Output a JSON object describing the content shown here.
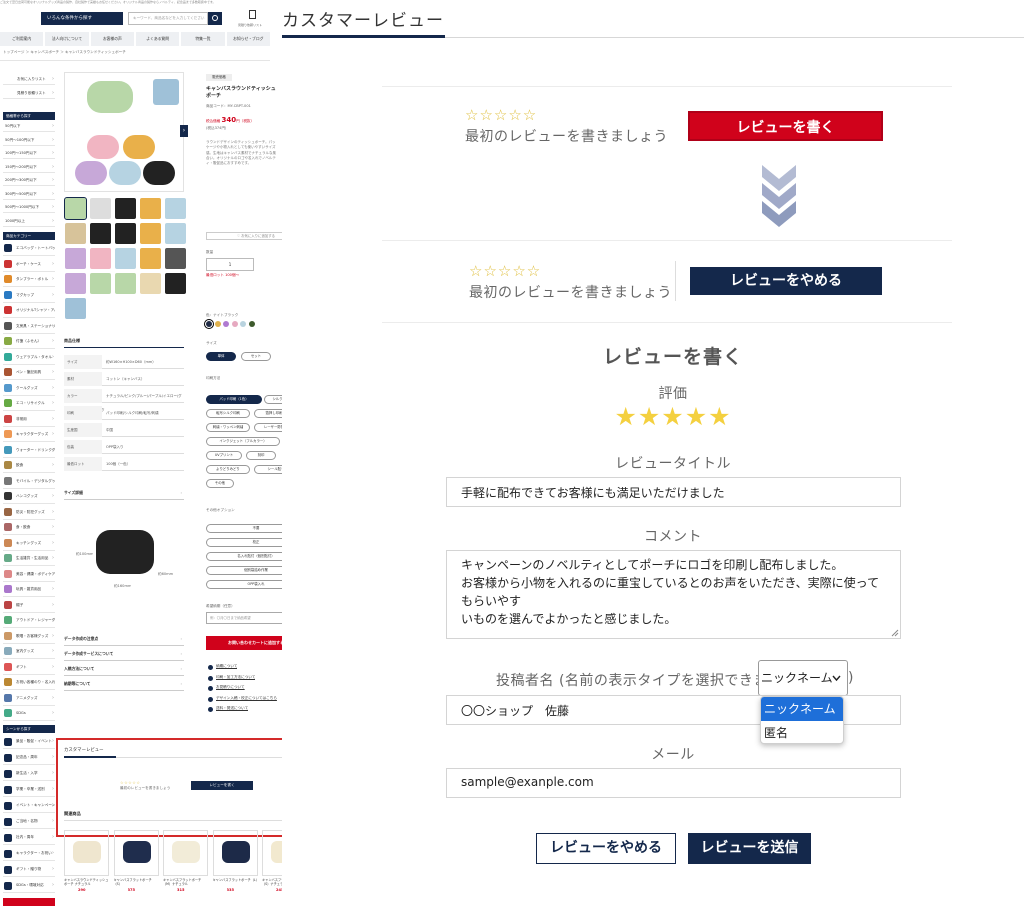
{
  "shop": {
    "header_notice": "ご注文で翌日出荷可能なオリジナルグッズ商品の製作、自社製作で実績もお任せください。オリジナル商品の製作ならノベルティ、記念品まで多数取扱中です。",
    "search_by_category": "いろんな条件から探す",
    "search_placeholder": "キーワード、商品名などを入力してください",
    "cart_label": "見積り依頼リスト",
    "global_nav": [
      "ご利用案内",
      "法人向けについて",
      "お客様の声",
      "よくある質問",
      "特集一覧",
      "お知らせ・ブログ"
    ],
    "breadcrumb": "トップページ ＞ キャンバスポーチ ＞ キャンバスラウンドティッシュポーチ",
    "side_top": [
      "お気に入りリスト",
      "見積り依頼リスト"
    ],
    "price_heading": "価格帯から探す",
    "price_ranges": [
      "50円以下",
      "50円〜100円以下",
      "100円〜150円以下",
      "150円〜200円以下",
      "200円〜300円以下",
      "300円〜500円以下",
      "500円〜1000円以下",
      "1000円以上"
    ],
    "category_heading": "商品カテゴリー",
    "categories": [
      "エコバッグ・トートバッグ",
      "ポーチ・ケース",
      "タンブラー・ボトル",
      "マグカップ",
      "オリジナルTシャツ・アパレル",
      "文房具・ステーショナリー",
      "付箋（ふせん）",
      "ウェアラブル・タオル",
      "ペン・筆記用具",
      "クールグッズ",
      "エコ・リサイクル",
      "非常用",
      "キャラクターグッズ",
      "ウォーター・ドリンクグッズ",
      "飲食",
      "モバイル・デジタルグッズ",
      "ハンコグッズ",
      "防災・防犯グッズ",
      "食・飲食",
      "キッチングッズ",
      "生活雑貨・生活用品",
      "美容・健康・ボディケア",
      "玩具・雑貨用品",
      "帽子",
      "アウトドア・レジャーグッズ",
      "歌唱・お客様グッズ",
      "室内グッズ",
      "ギフト",
      "お祝い各種のり・名入れグッズ",
      "アニメグッズ",
      "SDGs"
    ],
    "scene_heading": "シーンから探す",
    "scenes": [
      "景品・販促・イベント",
      "記念品・周年",
      "新生活・入学",
      "学業・卒業・送別",
      "イベント・キャンペーン",
      "ご当地・名物",
      "社内・周年",
      "キャラクター・お祝い",
      "ギフト・贈り物",
      "SDGs・環境対応"
    ],
    "product": {
      "tag": "販売価格",
      "name": "キャンバスラウンドティッシュポーチ",
      "code": "商品コード：MY-CBPT-001",
      "price_label": "税込価格",
      "price": "340",
      "price_unit": "円（税抜）",
      "price_note": "(税込374円)",
      "description": "ラウンドデザインのティッシュポーチ。パッケージや小物入れとしても使いやすいサイズ感。生地はキャンバス素材でナチュラルな風合い。オリジナルのロゴや名入れでノベルティ・販促品におすすめです。",
      "fav_button": "♡ お気に入りに追加する",
      "qty_label": "数量",
      "qty_value": "1",
      "qty_note": "最低ロット 100個〜",
      "color_label": "色：ナイトブラック",
      "size_label": "サイズ",
      "size_options": [
        "単体",
        "セット"
      ],
      "print_label": "印刷方法",
      "print_options": [
        "パッド印刷（1色）",
        "シルク印刷",
        "転写シルク印刷",
        "箔押し印刷",
        "刺繍・ワッペン刺繍",
        "レーザー彫刻",
        "インクジェット（フルカラー）",
        "UVプリント",
        "刻印",
        "よりどりみどり",
        "シール貼り",
        "その他"
      ],
      "option_label": "その他オプション",
      "option_items": [
        "不要",
        "校正",
        "名入れ貼付（個別貼付）",
        "個別袋詰め作業",
        "OPP袋入れ"
      ],
      "remarks_label": "希望納期（任意）",
      "remarks_placeholder": "例：〇月〇日まで納品希望",
      "cart_button": "お問い合わせカートに追加する",
      "links": [
        "納期について",
        "印刷・加工方法について",
        "お見積りについて",
        "デザイン入稿・校正についてはこちら",
        "送料・発送について"
      ]
    },
    "spec_heading": "商品仕様",
    "spec_rows": [
      [
        "サイズ",
        "約W160×H100×D60（mm）"
      ],
      [
        "素材",
        "コットン（キャンバス）"
      ],
      [
        "カラー",
        "ナチュラル/ピンク/ブルー/パープル/イエロー/グリーン/ネイビー/ブラック"
      ],
      [
        "印刷",
        "パッド印刷/シルク印刷/転写/刺繍"
      ],
      [
        "生産国",
        "中国"
      ],
      [
        "包装",
        "OPP袋入り"
      ],
      [
        "最低ロット",
        "100個（一色）"
      ]
    ],
    "size_heading": "サイズ詳細",
    "size_dims": [
      "約100mm",
      "約60mm",
      "約160mm"
    ],
    "accordions": [
      "データ作成の注意点",
      "データ作成サービスについて",
      "入稿方法について",
      "納期等について"
    ],
    "mini_review": {
      "title": "カスタマーレビュー",
      "prompt": "最初のレビューを書きましょう",
      "button": "レビューを書く"
    },
    "related_heading": "関連商品",
    "related": [
      {
        "name": "キャンバスラウンドティッシュポーチ ナチュラル",
        "price": "290"
      },
      {
        "name": "キャンバスフラットポーチ（S）",
        "price": "375"
      },
      {
        "name": "キャンバスフラットポーチ（M）ナチュラル",
        "price": "315"
      },
      {
        "name": "キャンバスフラットポーチ（L）",
        "price": "335"
      },
      {
        "name": "キャンバスフラットポーチ（S）ナチュラル",
        "price": "245"
      }
    ]
  },
  "review": {
    "heading": "カスタマーレビュー",
    "empty_prompt": "最初のレビューを書きましょう",
    "write_button": "レビューを書く",
    "cancel_button_top": "レビューをやめる",
    "form_title": "レビューを書く",
    "rating_label": "評価",
    "rating_value": 5,
    "rating_max": 5,
    "title_label": "レビュータイトル",
    "title_value": "手軽に配布できてお客様にも満足いただけました",
    "comment_label": "コメント",
    "comment_lines": [
      "キャンペーンのノベルティとしてポーチにロゴを印刷し配布しました。",
      "お客様から小物を入れるのに重宝しているとのお声をいただき、実際に使ってもらいやす",
      "いものを選んでよかったと感じました。"
    ],
    "author_label": "投稿者名 (名前の表示タイプを選択できます",
    "author_label_close": ")",
    "name_type_selected": "ニックネーム",
    "name_type_options": [
      "ニックネーム",
      "匿名"
    ],
    "author_value": "〇〇ショップ　佐藤",
    "email_label": "メール",
    "email_value": "sample@exanple.com",
    "cancel_button": "レビューをやめる",
    "submit_button": "レビューを送信"
  },
  "colors": {
    "navy": "#14284b",
    "red": "#d0021b",
    "star": "#f4d03f",
    "highlight": "#d42a2a",
    "chevron": "#8e9bbd"
  },
  "swatch_colors": [
    "#1f2a44",
    "#e0b24d",
    "#b07ad1",
    "#e6a9c0",
    "#b9d3df",
    "#3d5a2c"
  ],
  "related_colors": [
    "#efe6cf",
    "#1f2d4d",
    "#f2ecd8",
    "#1d2a48",
    "#f2e9cf"
  ]
}
